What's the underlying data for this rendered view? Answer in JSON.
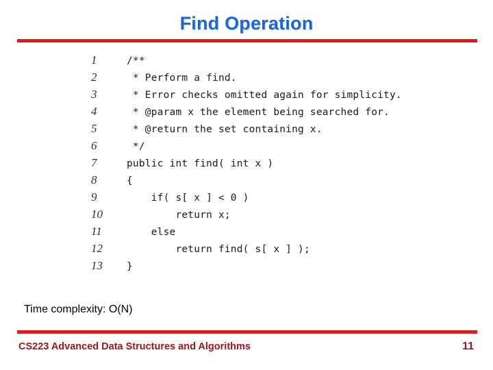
{
  "slide": {
    "title": "Find Operation",
    "accent_color": "#e01b1b",
    "title_color": "#1f66d0",
    "footer_color": "#9e1620"
  },
  "code": {
    "lines": [
      {
        "n": "1",
        "text": "/**"
      },
      {
        "n": "2",
        "text": " * Perform a find."
      },
      {
        "n": "3",
        "text": " * Error checks omitted again for simplicity."
      },
      {
        "n": "4",
        "text": " * @param x the element being searched for."
      },
      {
        "n": "5",
        "text": " * @return the set containing x."
      },
      {
        "n": "6",
        "text": " */"
      },
      {
        "n": "7",
        "text": "public int find( int x )"
      },
      {
        "n": "8",
        "text": "{"
      },
      {
        "n": "9",
        "text": "    if( s[ x ] < 0 )"
      },
      {
        "n": "10",
        "text": "        return x;"
      },
      {
        "n": "11",
        "text": "    else"
      },
      {
        "n": "12",
        "text": "        return find( s[ x ] );"
      },
      {
        "n": "13",
        "text": "}"
      }
    ]
  },
  "complexity": {
    "note": "Time complexity: O(N)"
  },
  "footer": {
    "course": "CS223 Advanced Data Structures and Algorithms",
    "page_number": "11"
  }
}
